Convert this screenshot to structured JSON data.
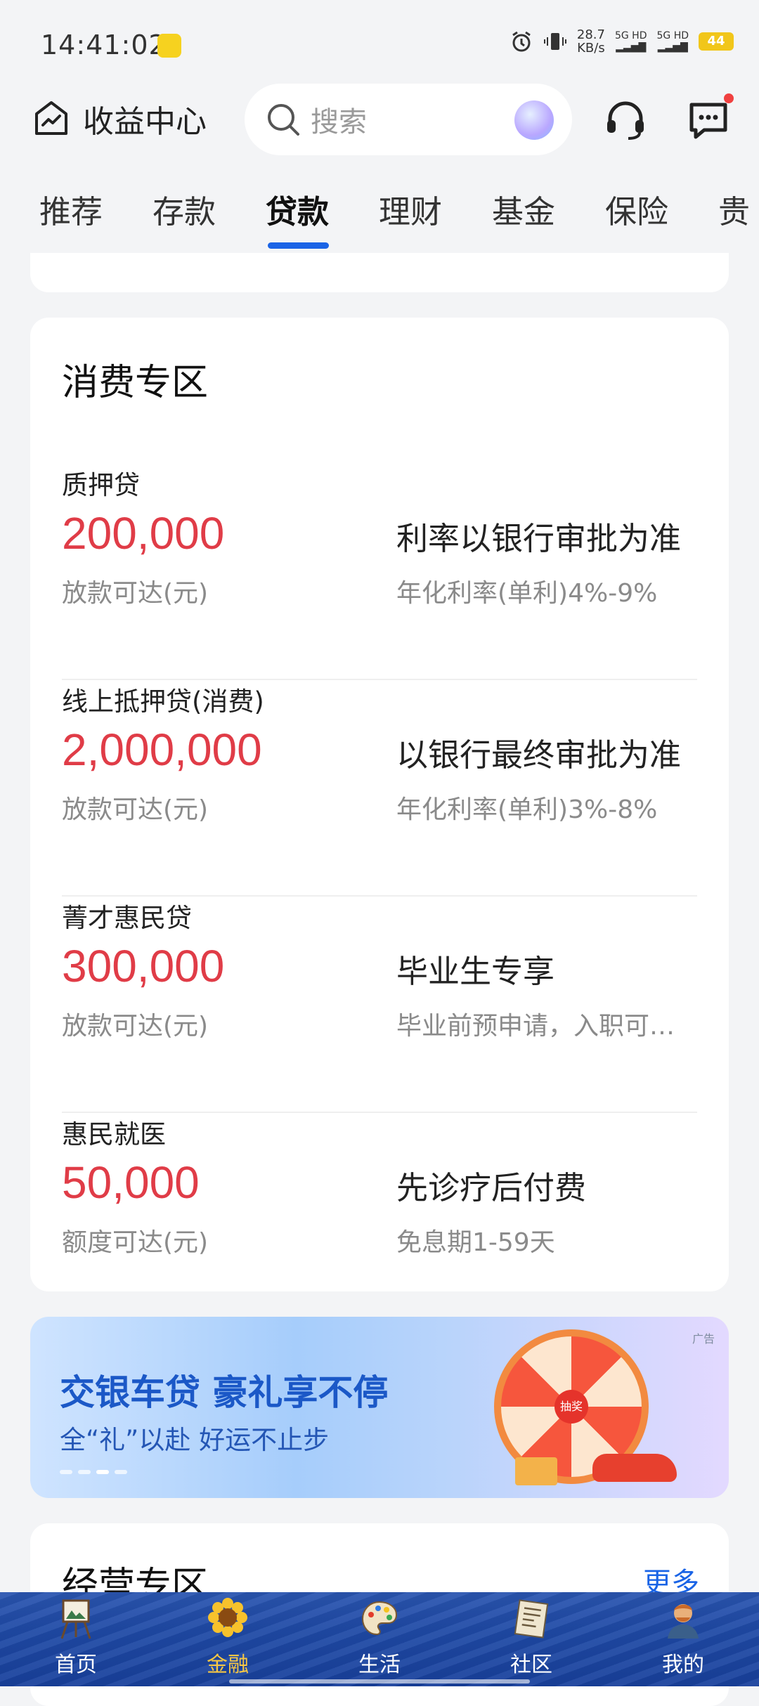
{
  "status_bar": {
    "time": "14:41:02",
    "net_speed_value": "28.7",
    "net_speed_unit": "KB/s",
    "sim1": "5G HD",
    "sim2": "5G HD",
    "battery": "44"
  },
  "header": {
    "title": "收益中心",
    "search_placeholder": "搜索"
  },
  "tabs": [
    {
      "label": "推荐",
      "active": false
    },
    {
      "label": "存款",
      "active": false
    },
    {
      "label": "贷款",
      "active": true
    },
    {
      "label": "理财",
      "active": false
    },
    {
      "label": "基金",
      "active": false
    },
    {
      "label": "保险",
      "active": false
    },
    {
      "label": "贵",
      "active": false
    }
  ],
  "consumer_section": {
    "title": "消费专区",
    "loans": [
      {
        "name": "质押贷",
        "amount": "200,000",
        "amount_label": "放款可达(元)",
        "feature": "利率以银行审批为准",
        "detail": "年化利率(单利)4%-9%"
      },
      {
        "name": "线上抵押贷(消费)",
        "amount": "2,000,000",
        "amount_label": "放款可达(元)",
        "feature": "以银行最终审批为准",
        "detail": "年化利率(单利)3%-8%"
      },
      {
        "name": "菁才惠民贷",
        "amount": "300,000",
        "amount_label": "放款可达(元)",
        "feature": "毕业生专享",
        "detail": "毕业前预申请，入职可…"
      },
      {
        "name": "惠民就医",
        "amount": "50,000",
        "amount_label": "额度可达(元)",
        "feature": "先诊疗后付费",
        "detail": "免息期1-59天"
      }
    ]
  },
  "banner": {
    "ad_tag": "广告",
    "title": "交银车贷 豪礼享不停",
    "subtitle": "全“礼”以赴 好运不止步",
    "wheel_center": "抽奖",
    "page_count": 4,
    "active_page": 3
  },
  "business_section": {
    "title": "经营专区",
    "more": "更多"
  },
  "bottom_nav": [
    {
      "label": "首页",
      "icon": "painting-easel-icon",
      "active": false
    },
    {
      "label": "金融",
      "icon": "sunflower-icon",
      "active": true
    },
    {
      "label": "生活",
      "icon": "palette-icon",
      "active": false
    },
    {
      "label": "社区",
      "icon": "newspaper-icon",
      "active": false
    },
    {
      "label": "我的",
      "icon": "portrait-avatar-icon",
      "active": false
    }
  ],
  "colors": {
    "accent_blue": "#1a64e6",
    "amount_red": "#e03c47",
    "nav_active": "#f7c744"
  }
}
